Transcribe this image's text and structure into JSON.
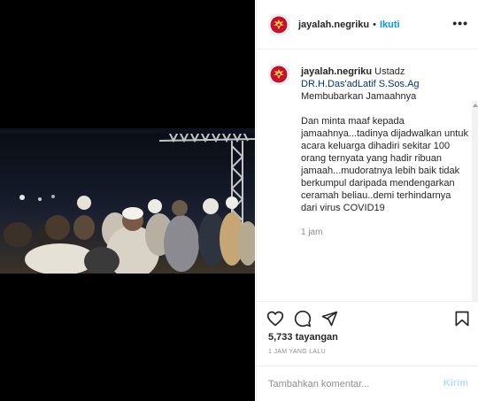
{
  "post": {
    "username": "jayalah.negriku",
    "separator": "•",
    "follow_label": "Ikuti",
    "more_icon": "more-horizontal-icon",
    "caption": {
      "username": "jayalah.negriku",
      "line1": "Ustadz",
      "tag": "DR.H.Das'adLatif S.Sos.Ag",
      "line2": "Membubarkan Jamaahnya",
      "paragraph": "Dan minta maaf kepada jamaahnya...tadinya dijadwalkan untuk acara keluarga dihadiri sekitar 100 orang ternyata yang hadir ribuan jamaah...mudoratnya lebih baik tidak berkumpul daripada mendengarkan ceramah beliau..demi terhindarnya dari virus COVID19",
      "time": "1 jam"
    },
    "views": "5,733 tayangan",
    "timestamp": "1 JAM YANG LALU",
    "comment": {
      "placeholder": "Tambahkan komentar...",
      "post_label": "Kirim"
    },
    "icons": {
      "like": "heart-icon",
      "comment": "comment-icon",
      "share": "share-icon",
      "save": "bookmark-icon"
    },
    "colors": {
      "link": "#0095f6",
      "tag": "#00376b",
      "muted": "#8e8e8e",
      "avatar_red": "#c8102e"
    }
  }
}
